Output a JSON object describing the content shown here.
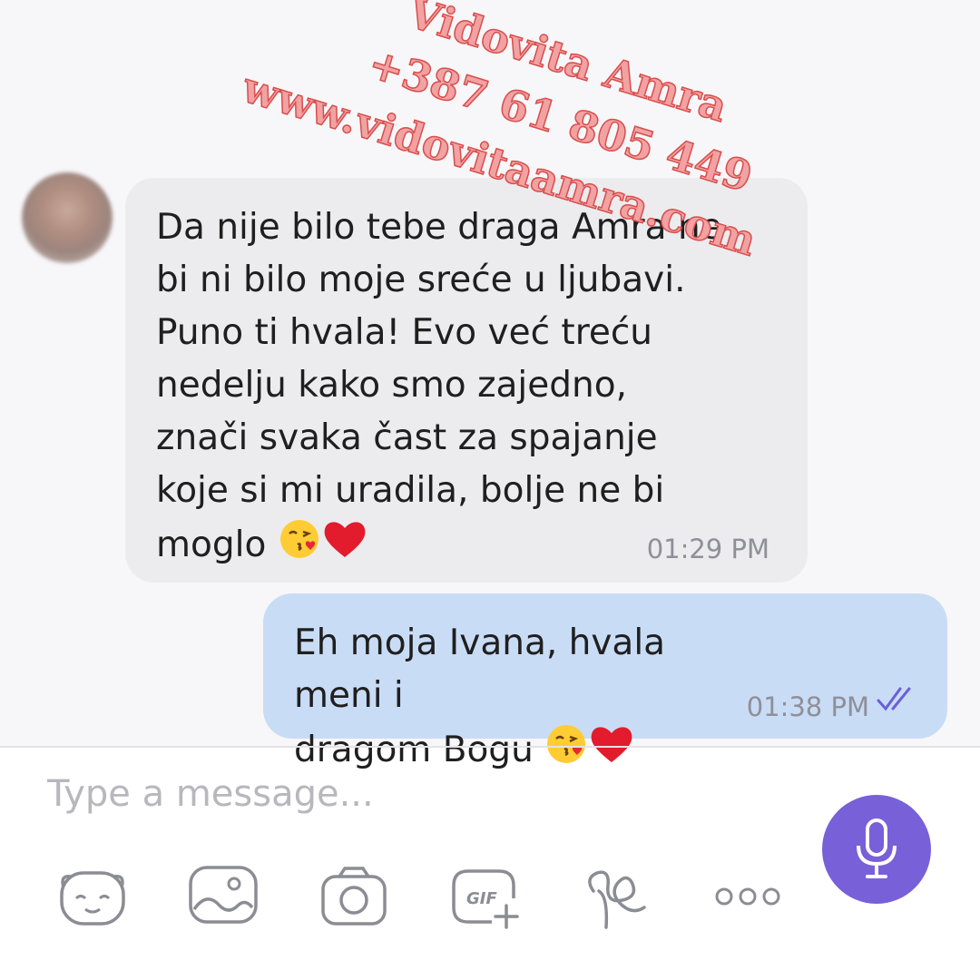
{
  "conversation": {
    "incoming": {
      "lines": [
        "Da nije bilo tebe draga Amra ne",
        "bi ni bilo moje sreće u ljubavi.",
        "Puno ti hvala! Evo već treću",
        "nedelju kako smo zajedno,",
        "znači svaka čast za spajanje",
        "koje si mi uradila, bolje ne bi",
        "moglo"
      ],
      "time": "01:29 PM",
      "emojis": [
        "kissing-face-icon",
        "red-heart-icon"
      ]
    },
    "outgoing": {
      "lines": [
        "Eh moja Ivana, hvala meni i",
        "dragom Bogu"
      ],
      "time": "01:38 PM",
      "status_icon": "double-check-icon",
      "emojis": [
        "kissing-face-icon",
        "red-heart-icon"
      ]
    }
  },
  "watermark": {
    "name": "Vidovita Amra",
    "phone": "+387 61 805 449",
    "website": "www.vidovitaamra.com"
  },
  "composer": {
    "placeholder": "Type a message...",
    "toolbar_icons": [
      "sticker-icon",
      "gallery-icon",
      "camera-icon",
      "gif-icon",
      "doodle-icon",
      "more-icon"
    ],
    "send_icon": "microphone-icon"
  },
  "colors": {
    "incoming_bubble": "#ececee",
    "outgoing_bubble": "#c9dcf6",
    "accent": "#7860d8",
    "watermark": "#d94d4d"
  }
}
